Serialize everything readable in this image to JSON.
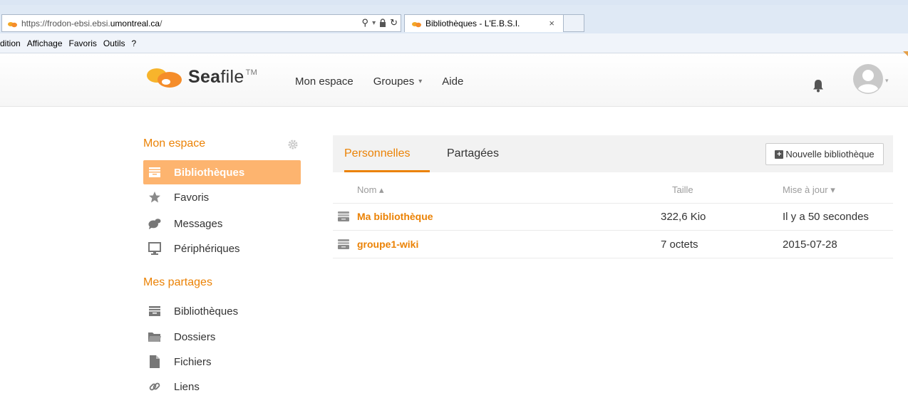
{
  "browser": {
    "url_prefix": "https://frodon-ebsi.ebsi.",
    "url_domain": "umontreal.ca",
    "url_suffix": "/",
    "tab_title": "Bibliothèques - L'E.B.S.I.",
    "tab_close": "×",
    "tools": {
      "search": "⚲",
      "dropdown": "▾",
      "lock": "🔒",
      "refresh": "↻"
    },
    "menu": [
      "dition",
      "Affichage",
      "Favoris",
      "Outils",
      "?"
    ]
  },
  "header": {
    "logo_sea": "Sea",
    "logo_file": "file",
    "logo_tm": "TM",
    "nav": {
      "mon_espace": "Mon espace",
      "groupes": "Groupes",
      "aide": "Aide"
    },
    "caret": "▾"
  },
  "sidebar": {
    "mon_espace_heading": "Mon espace",
    "items": [
      {
        "label": "Bibliothèques",
        "icon": "library-icon",
        "active": true
      },
      {
        "label": "Favoris",
        "icon": "star-icon"
      },
      {
        "label": "Messages",
        "icon": "messages-icon"
      },
      {
        "label": "Périphériques",
        "icon": "monitor-icon"
      }
    ],
    "mes_partages_heading": "Mes partages",
    "share_items": [
      {
        "label": "Bibliothèques",
        "icon": "library-icon"
      },
      {
        "label": "Dossiers",
        "icon": "folder-icon"
      },
      {
        "label": "Fichiers",
        "icon": "file-icon"
      },
      {
        "label": "Liens",
        "icon": "link-icon"
      }
    ]
  },
  "main": {
    "tabs": {
      "personnelles": "Personnelles",
      "partagees": "Partagées"
    },
    "new_library_button": "Nouvelle bibliothèque",
    "columns": {
      "nom": "Nom ▴",
      "taille": "Taille",
      "mise_a_jour": "Mise à jour ▾"
    },
    "rows": [
      {
        "name": "Ma bibliothèque",
        "size": "322,6 Kio",
        "updated": "Il y a 50 secondes"
      },
      {
        "name": "groupe1-wiki",
        "size": "7 octets",
        "updated": "2015-07-28"
      }
    ]
  },
  "colors": {
    "accent": "#eb8205",
    "active_bg": "#fdb46f"
  }
}
